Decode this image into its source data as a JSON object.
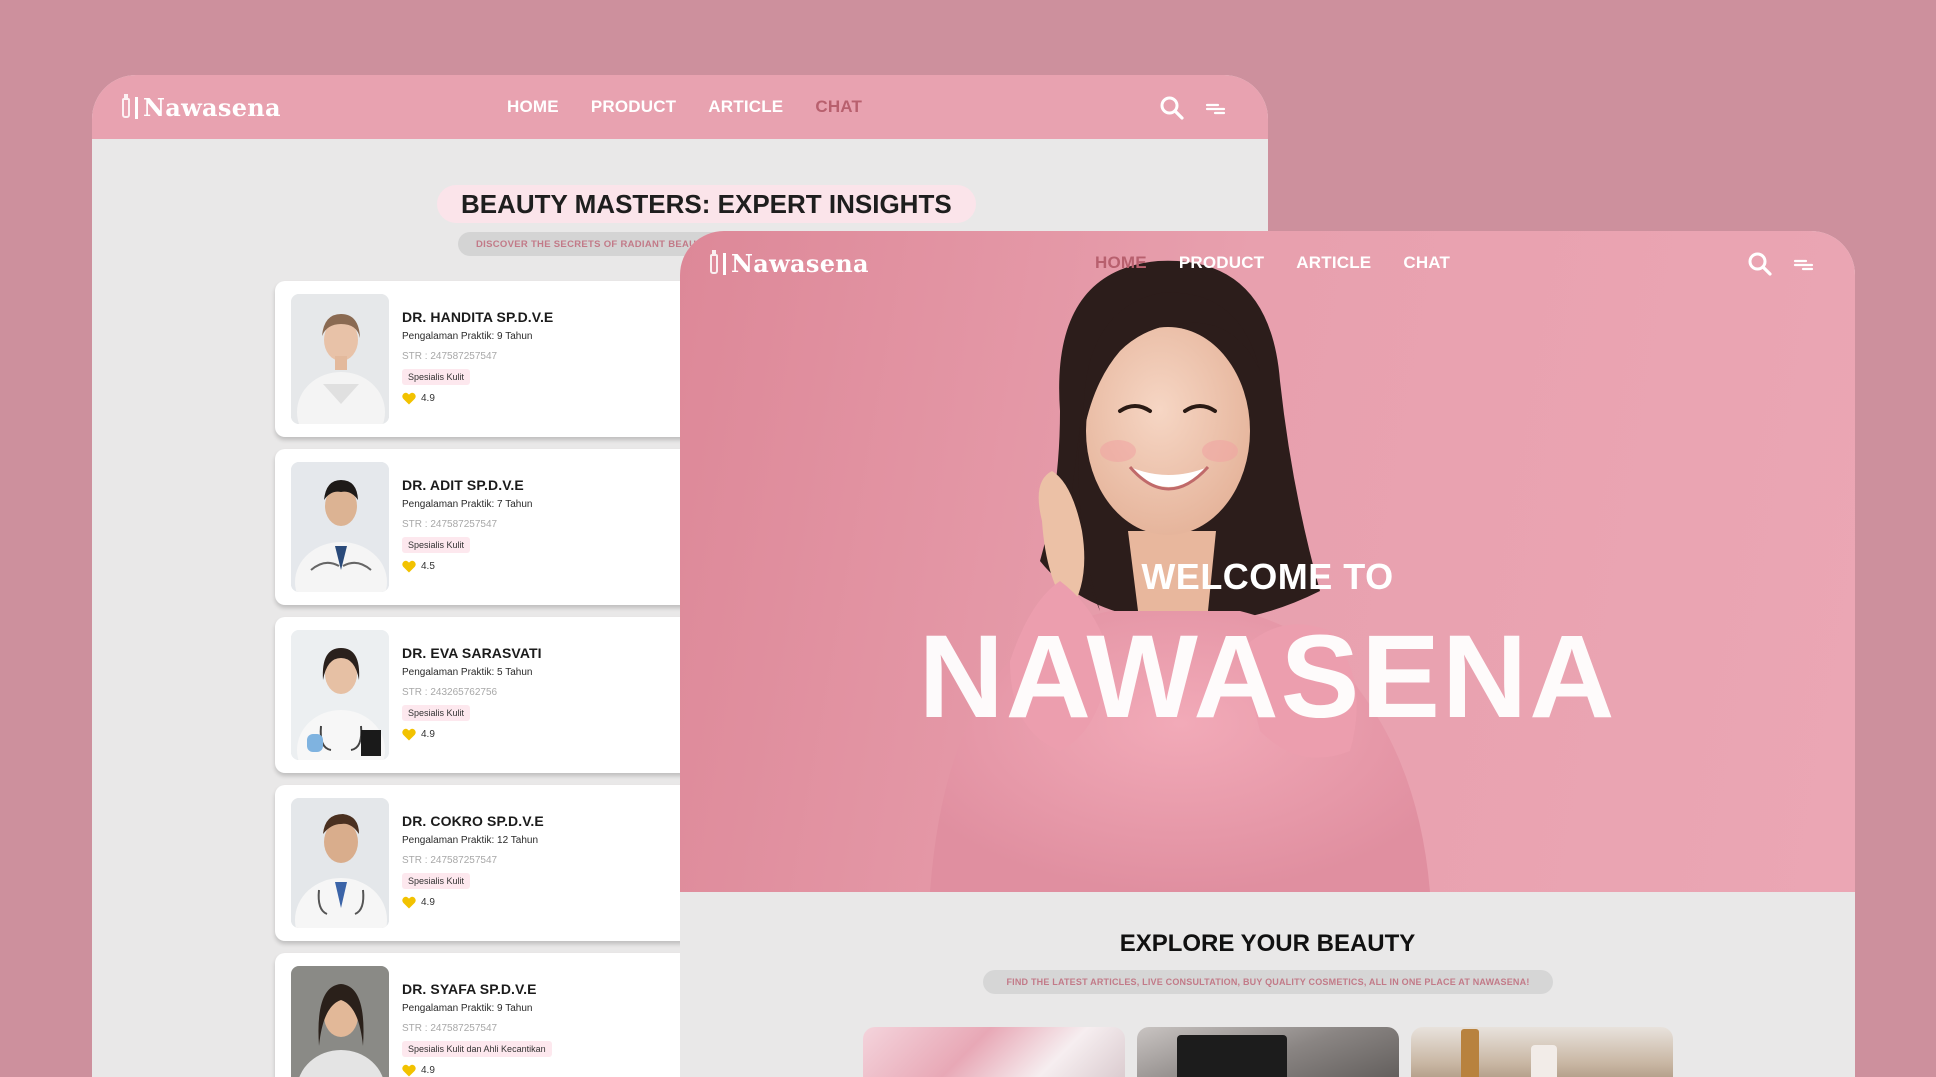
{
  "back_window": {
    "logo": "Nawasena",
    "nav": [
      "HOME",
      "PRODUCT",
      "ARTICLE",
      "CHAT"
    ],
    "active_nav": "CHAT",
    "section_title": "BEAUTY MASTERS: EXPERT INSIGHTS",
    "section_subtitle": "DISCOVER THE SECRETS OF RADIANT BEAUTY",
    "doctors": [
      {
        "name": "DR. HANDITA SP.D.V.E",
        "experience": "Pengalaman Praktik: 9 Tahun",
        "str": "STR : 247587257547",
        "specialty": "Spesialis Kulit",
        "rating": "4.9"
      },
      {
        "name": "DR. ADIT SP.D.V.E",
        "experience": "Pengalaman Praktik: 7 Tahun",
        "str": "STR : 247587257547",
        "specialty": "Spesialis Kulit",
        "rating": "4.5"
      },
      {
        "name": "DR. EVA SARASVATI",
        "experience": "Pengalaman Praktik: 5 Tahun",
        "str": "STR : 243265762756",
        "specialty": "Spesialis Kulit",
        "rating": "4.9"
      },
      {
        "name": "DR. COKRO SP.D.V.E",
        "experience": "Pengalaman Praktik: 12 Tahun",
        "str": "STR : 247587257547",
        "specialty": "Spesialis Kulit",
        "rating": "4.9"
      },
      {
        "name": "DR. SYAFA SP.D.V.E",
        "experience": "Pengalaman Praktik: 9 Tahun",
        "str": "STR : 247587257547",
        "specialty": "Spesialis Kulit dan Ahli Kecantikan",
        "rating": "4.9"
      }
    ]
  },
  "front_window": {
    "logo": "Nawasena",
    "nav": [
      "HOME",
      "PRODUCT",
      "ARTICLE",
      "CHAT"
    ],
    "active_nav": "HOME",
    "hero_welcome": "WELCOME TO",
    "hero_title": "NAWASENA",
    "explore_title": "EXPLORE YOUR BEAUTY",
    "explore_subtitle": "FIND THE LATEST ARTICLES, LIVE CONSULTATION, BUY QUALITY COSMETICS, ALL IN ONE PLACE AT NAWASENA!"
  },
  "colors": {
    "background": "#cd909d",
    "nav_pink": "#e8a2b0",
    "active_nav": "#b8606e",
    "rating_heart": "#f2c200"
  },
  "icons": [
    "search-icon",
    "menu-icon",
    "heart-icon",
    "logo-bottle-icon"
  ]
}
